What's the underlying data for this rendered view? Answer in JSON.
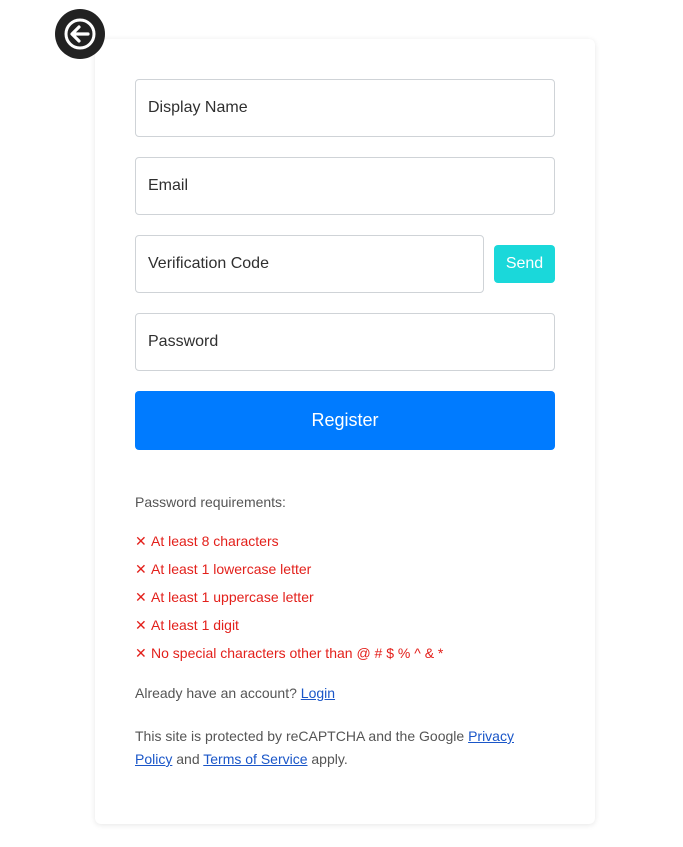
{
  "header": {
    "back_icon": "arrow-left-icon"
  },
  "form": {
    "display_name_placeholder": "Display Name",
    "email_placeholder": "Email",
    "verification_code_placeholder": "Verification Code",
    "password_placeholder": "Password",
    "send_label": "Send",
    "register_label": "Register"
  },
  "requirements": {
    "heading": "Password requirements:",
    "mark": "✕",
    "items": [
      "At least 8 characters",
      "At least 1 lowercase letter",
      "At least 1 uppercase letter",
      "At least 1 digit",
      "No special characters other than @ # $ % ^ & *"
    ]
  },
  "login": {
    "prompt": "Already have an account?",
    "link": "Login"
  },
  "recaptcha": {
    "prefix": "This site is protected by reCAPTCHA and the Google",
    "privacy_link": "Privacy Policy",
    "and": "and",
    "terms_link": "Terms of Service",
    "suffix": "apply."
  },
  "colors": {
    "send": "#1ad8da",
    "register": "#007bff",
    "error": "#e3201b",
    "link": "#1a56c8"
  }
}
